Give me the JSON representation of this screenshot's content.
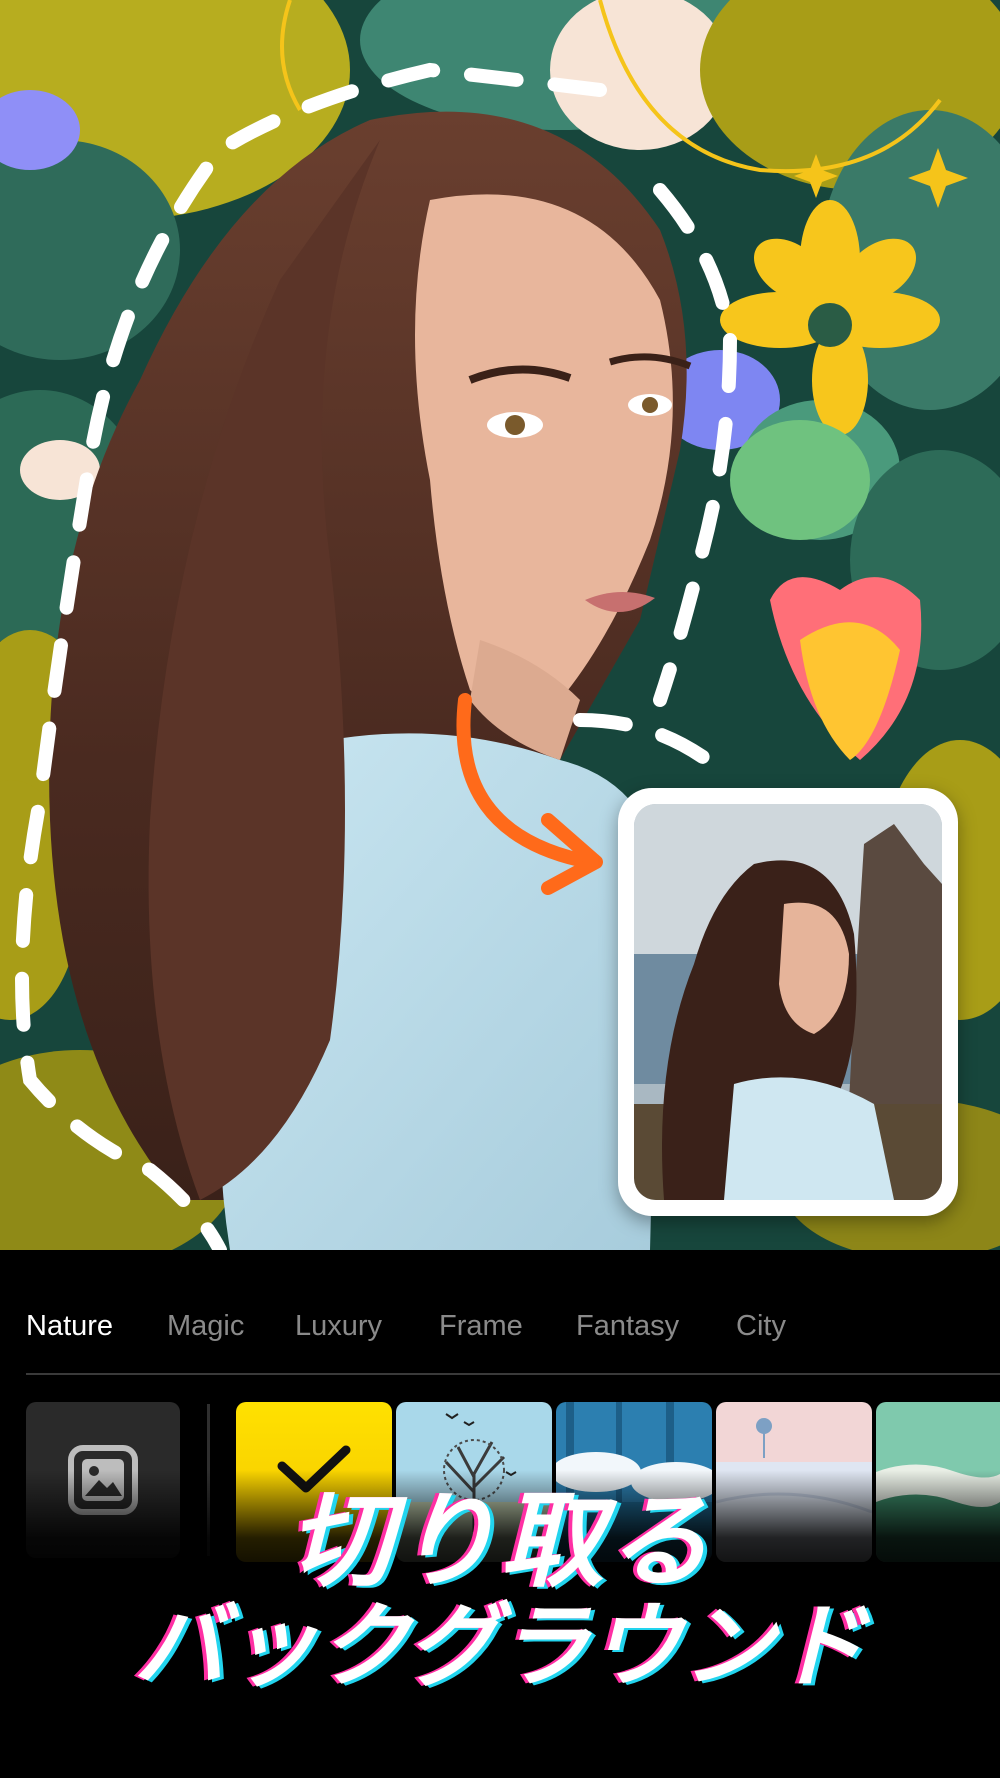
{
  "categories": {
    "tabs": [
      {
        "label": "Nature",
        "active": true
      },
      {
        "label": "Magic",
        "active": false
      },
      {
        "label": "Luxury",
        "active": false
      },
      {
        "label": "Frame",
        "active": false
      },
      {
        "label": "Fantasy",
        "active": false
      },
      {
        "label": "City",
        "active": false
      }
    ]
  },
  "gallery": {
    "icon": "image-gallery-icon"
  },
  "backgrounds": [
    {
      "name": "yellow-gradient",
      "selected": true,
      "icon": "checkmark-icon"
    },
    {
      "name": "bare-tree-birds",
      "selected": false
    },
    {
      "name": "blue-forest-clouds",
      "selected": false
    },
    {
      "name": "snowy-field-tree",
      "selected": false
    },
    {
      "name": "green-hills",
      "selected": false
    }
  ],
  "promo": {
    "line1": "切り取る",
    "line2": "バックグラウンド"
  },
  "colors": {
    "accent_arrow": "#ff6a1a",
    "selected_bg": "#ffd800",
    "caption_pink": "#ff2fa4",
    "caption_cyan": "#22d4ee"
  }
}
